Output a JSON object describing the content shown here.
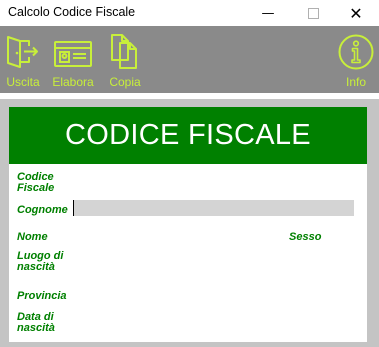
{
  "window": {
    "title": "Calcolo Codice Fiscale",
    "minimize_glyph": "—",
    "close_glyph": "✕"
  },
  "toolbar": {
    "accent_color": "#c8ef3a",
    "background_color": "#8a8a8a",
    "buttons": [
      {
        "label": "Uscita",
        "icon": "exit-door-icon"
      },
      {
        "label": "Elabora",
        "icon": "id-card-icon"
      },
      {
        "label": "Copia",
        "icon": "copy-documents-icon"
      },
      {
        "label": "Info",
        "icon": "info-circle-icon"
      }
    ]
  },
  "form": {
    "header_title": "CODICE FISCALE",
    "header_color": "#008000",
    "label_color": "#008000",
    "codice_fiscale_label": [
      "Codice",
      "Fiscale"
    ],
    "cognome_label": "Cognome",
    "cognome_value": "",
    "nome_label": "Nome",
    "sesso_label": "Sesso",
    "luogo_label": [
      "Luogo di",
      "nascità"
    ],
    "provincia_label": "Provincia",
    "data_label": [
      "Data di",
      "nascità"
    ]
  }
}
